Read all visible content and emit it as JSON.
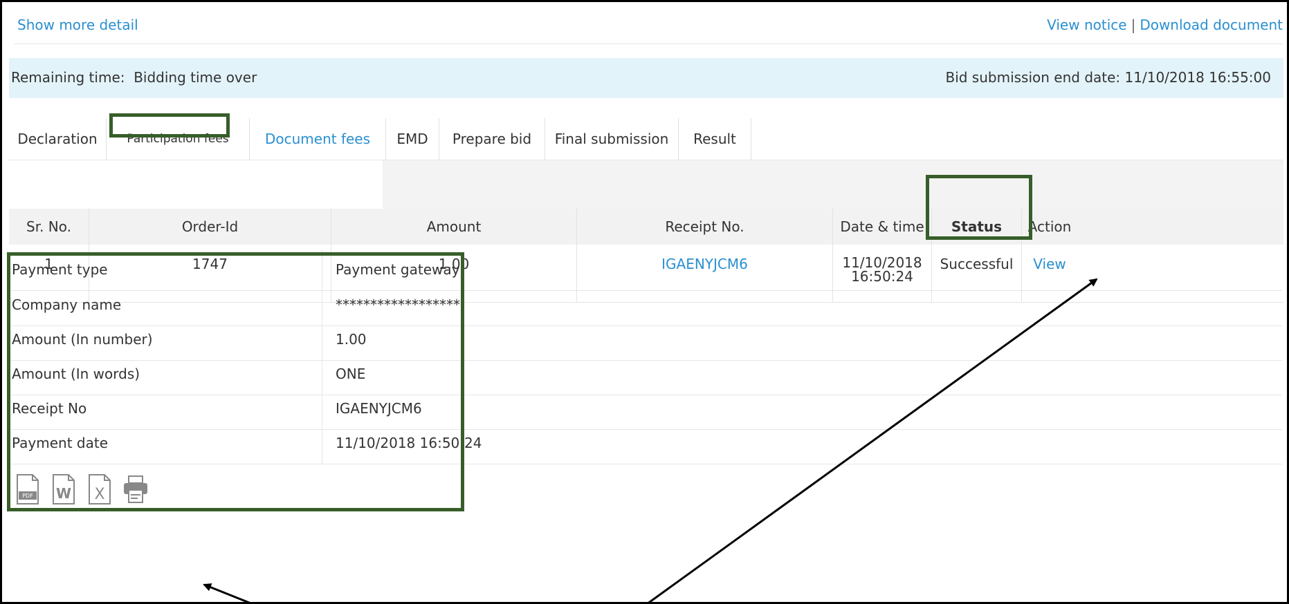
{
  "links": {
    "show_more": "Show more detail",
    "view_notice": "View notice",
    "separator": "|",
    "download_document": "Download document"
  },
  "info": {
    "remaining_time_label": "Remaining time:",
    "remaining_time_value": "Bidding time over",
    "end_date_label": "Bid submission end date:",
    "end_date_value": "11/10/2018 16:55:00"
  },
  "tabs": [
    {
      "label": "Declaration"
    },
    {
      "label": "Participation fees"
    },
    {
      "label": "Document fees"
    },
    {
      "label": "EMD"
    },
    {
      "label": "Prepare bid"
    },
    {
      "label": "Final submission"
    },
    {
      "label": "Result"
    }
  ],
  "table": {
    "headers": [
      "Sr. No.",
      "Order-Id",
      "Amount",
      "Receipt No.",
      "Date & time",
      "Status",
      "Action"
    ],
    "row": {
      "sr": "1",
      "order_id": "1747",
      "amount": "1.00",
      "receipt": "IGAENYJCM6",
      "date": "11/10/2018",
      "time": "16:50:24",
      "status": "Successful",
      "action": "View"
    }
  },
  "details": [
    {
      "key": "Payment type",
      "value": "Payment gateway"
    },
    {
      "key": "Company name",
      "value": "******************"
    },
    {
      "key": "Amount (In number)",
      "value": "1.00"
    },
    {
      "key": "Amount (In words)",
      "value": "ONE"
    },
    {
      "key": "Receipt No",
      "value": "IGAENYJCM6"
    },
    {
      "key": "Payment date",
      "value": "11/10/2018 16:50:24"
    }
  ],
  "export_icons": [
    "pdf-icon",
    "word-icon",
    "excel-icon",
    "printer-icon"
  ],
  "colors": {
    "link": "#2a8fd0",
    "highlight": "#375e2a",
    "band": "#e3f3fa"
  }
}
